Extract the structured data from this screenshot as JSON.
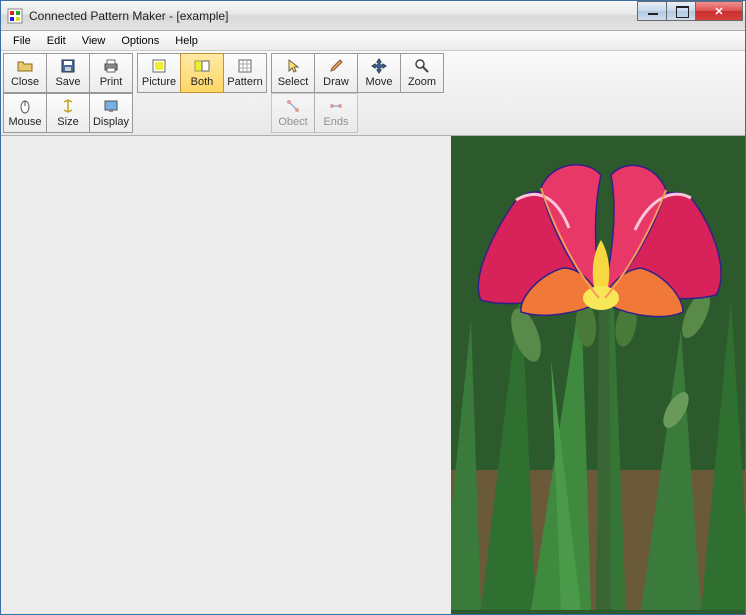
{
  "title": "Connected Pattern Maker - [example]",
  "menus": {
    "file": "File",
    "edit": "Edit",
    "view": "View",
    "options": "Options",
    "help": "Help"
  },
  "toolbar": {
    "row1": {
      "close": "Close",
      "save": "Save",
      "print": "Print",
      "picture": "Picture",
      "both": "Both",
      "pattern": "Pattern",
      "select": "Select",
      "draw": "Draw",
      "move": "Move",
      "zoom": "Zoom"
    },
    "row2": {
      "mouse": "Mouse",
      "size": "Size",
      "display": "Display",
      "obect": "Obect",
      "ends": "Ends"
    }
  },
  "active_view": "both",
  "picture_subject": "daylily flower"
}
